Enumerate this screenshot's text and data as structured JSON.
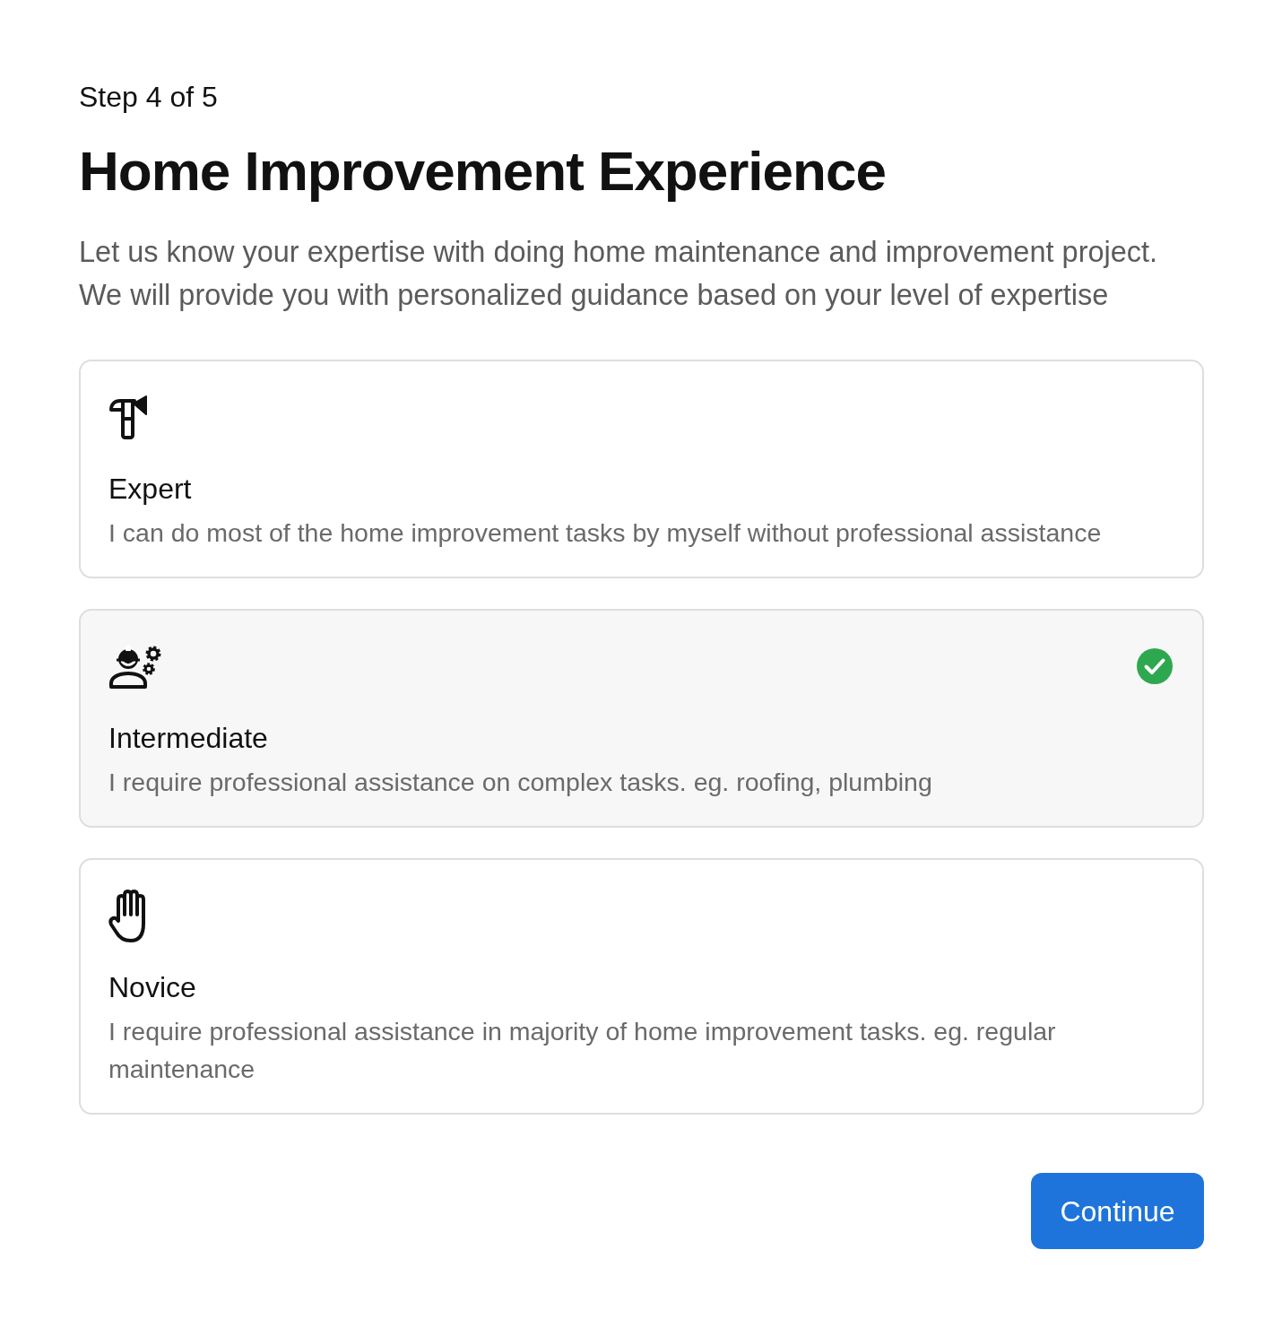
{
  "step": "Step 4 of 5",
  "title": "Home Improvement Experience",
  "description": [
    "Let us know your expertise with doing home maintenance and improvement project.",
    "We will provide you with personalized guidance based on your level of expertise"
  ],
  "options": [
    {
      "kind": "expert",
      "label": "Expert",
      "description": "I can do most of the home improvement tasks by myself without professional assistance",
      "selected": false
    },
    {
      "kind": "intermediate",
      "label": "Intermediate",
      "description": "I require professional assistance on complex tasks. eg. roofing, plumbing",
      "selected": true
    },
    {
      "kind": "novice",
      "label": "Novice",
      "description": "I require professional assistance in majority of home improvement tasks. eg. regular maintenance",
      "selected": false
    }
  ],
  "button": {
    "label": "Continue"
  }
}
